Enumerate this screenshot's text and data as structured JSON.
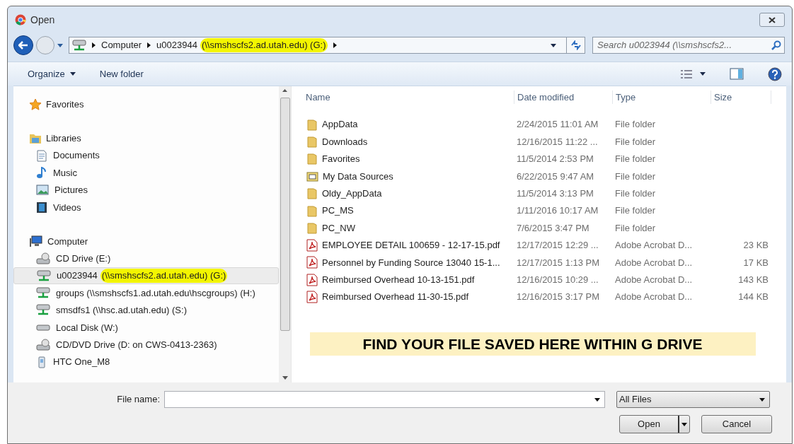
{
  "window": {
    "title": "Open"
  },
  "address": {
    "segments": [
      {
        "parts": [
          {
            "text": "Computer",
            "highlighted": false
          }
        ]
      },
      {
        "parts": [
          {
            "text": "u0023944",
            "highlighted": false
          },
          {
            "text": "(\\\\smshscfs2.ad.utah.edu) (G:)",
            "highlighted": true
          }
        ]
      }
    ]
  },
  "search": {
    "placeholder": "Search u0023944 (\\\\smshscfs2..."
  },
  "toolbar": [
    {
      "label": "Organize",
      "kind": "menu"
    },
    {
      "label": "New folder",
      "kind": "button"
    }
  ],
  "sidebar": {
    "groups": [
      {
        "label": "Favorites",
        "kind": "favorites"
      },
      {
        "label": "Libraries",
        "kind": "libraries",
        "children": [
          {
            "label": [
              {
                "text": "Documents",
                "highlighted": false
              }
            ],
            "kind": "documents",
            "selected": false
          },
          {
            "label": [
              {
                "text": "Music",
                "highlighted": false
              }
            ],
            "kind": "music",
            "selected": false
          },
          {
            "label": [
              {
                "text": "Pictures",
                "highlighted": false
              }
            ],
            "kind": "pictures",
            "selected": false
          },
          {
            "label": [
              {
                "text": "Videos",
                "highlighted": false
              }
            ],
            "kind": "videos",
            "selected": false
          }
        ]
      },
      {
        "label": "Computer",
        "kind": "computer",
        "children": [
          {
            "label": [
              {
                "text": "CD Drive (E:)",
                "highlighted": false
              }
            ],
            "kind": "cd",
            "selected": false
          },
          {
            "label": [
              {
                "text": "u0023944",
                "highlighted": false
              },
              {
                "text": "(\\\\smshscfs2.ad.utah.edu) (G:)",
                "highlighted": true
              }
            ],
            "kind": "network",
            "selected": true
          },
          {
            "label": [
              {
                "text": "groups (\\\\smshscfs1.ad.utah.edu\\hscgroups) (H:)",
                "highlighted": false
              }
            ],
            "kind": "network",
            "selected": false
          },
          {
            "label": [
              {
                "text": "smsdfs1 (\\\\hsc.ad.utah.edu) (S:)",
                "highlighted": false
              }
            ],
            "kind": "network",
            "selected": false
          },
          {
            "label": [
              {
                "text": "Local Disk (W:)",
                "highlighted": false
              }
            ],
            "kind": "disk",
            "selected": false
          },
          {
            "label": [
              {
                "text": "CD/DVD Drive (D: on CWS-0413-2363)",
                "highlighted": false
              }
            ],
            "kind": "cd",
            "selected": false
          },
          {
            "label": [
              {
                "text": "HTC One_M8",
                "highlighted": false
              }
            ],
            "kind": "phone",
            "selected": false
          }
        ]
      }
    ]
  },
  "table": {
    "columns": [
      "Name",
      "Date modified",
      "Type",
      "Size"
    ],
    "rows": [
      {
        "kind": "folder",
        "name": "AppData",
        "date": "2/24/2015 11:01 AM",
        "type": "File folder"
      },
      {
        "kind": "folder",
        "name": "Downloads",
        "date": "12/16/2015 11:22 ...",
        "type": "File folder"
      },
      {
        "kind": "folder",
        "name": "Favorites",
        "date": "11/5/2014 2:53 PM",
        "type": "File folder"
      },
      {
        "kind": "datasource",
        "name": "My Data Sources",
        "date": "6/22/2015 9:47 AM",
        "type": "File folder"
      },
      {
        "kind": "folder",
        "name": "Oldy_AppData",
        "date": "11/5/2014 3:13 PM",
        "type": "File folder"
      },
      {
        "kind": "folder",
        "name": "PC_MS",
        "date": "1/11/2016 10:17 AM",
        "type": "File folder"
      },
      {
        "kind": "folder",
        "name": "PC_NW",
        "date": "7/6/2015 3:47 PM",
        "type": "File folder"
      },
      {
        "kind": "pdf",
        "name": "EMPLOYEE DETAIL 100659 - 12-17-15.pdf",
        "date": "12/17/2015 12:29 ...",
        "type": "Adobe Acrobat D...",
        "size": "23 KB"
      },
      {
        "kind": "pdf",
        "name": "Personnel by Funding Source 13040 15-1...",
        "date": "12/17/2015 1:13 PM",
        "type": "Adobe Acrobat D...",
        "size": "17 KB"
      },
      {
        "kind": "pdf",
        "name": "Reimbursed Overhead 10-13-151.pdf",
        "date": "12/16/2015 10:29 ...",
        "type": "Adobe Acrobat D...",
        "size": "143 KB"
      },
      {
        "kind": "pdf",
        "name": "Reimbursed Overhead 11-30-15.pdf",
        "date": "12/16/2015 3:17 PM",
        "type": "Adobe Acrobat D...",
        "size": "144 KB"
      }
    ]
  },
  "banner": {
    "text": "FIND YOUR FILE SAVED HERE WITHIN G DRIVE"
  },
  "footer": {
    "file_name_label": "File name:",
    "filter": "All Files",
    "buttons": [
      "Open",
      "Cancel"
    ]
  }
}
